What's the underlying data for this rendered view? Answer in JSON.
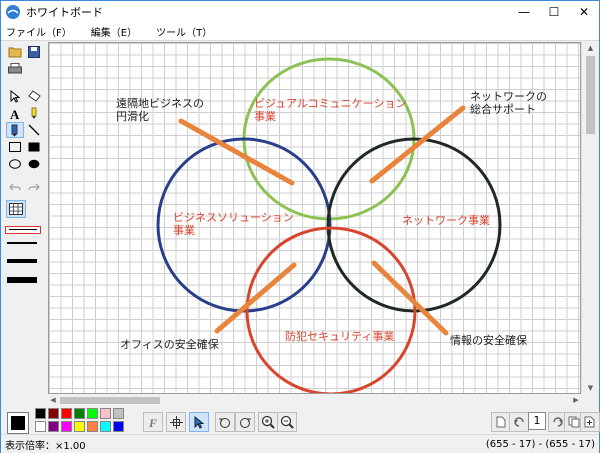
{
  "window": {
    "title": "ホワイトボード",
    "min": "—",
    "max": "☐",
    "close": "✕"
  },
  "menu": [
    "ファイル（F）",
    "編集（E）",
    "ツール（T）"
  ],
  "canvas": {
    "labels": {
      "top_circle": [
        "ビジュアルコミュニケーション",
        "事業"
      ],
      "left_circle": [
        "ビジネスソリューション",
        "事業"
      ],
      "right_circle": [
        "ネットワーク事業"
      ],
      "bottom_circle": [
        "防犯セキュリティ事業"
      ],
      "remote": [
        "遠隔地ビジネスの",
        "円滑化"
      ],
      "network_support": [
        "ネットワークの",
        "総合サポート"
      ],
      "office": [
        "オフィスの安全確保"
      ],
      "info": [
        "情報の安全確保"
      ]
    },
    "colors": {
      "green": "#8cc153",
      "blue": "#2a3f8a",
      "black": "#1e2a22",
      "red": "#d8452e",
      "orange": "#e8843b"
    }
  },
  "palette": [
    "#000000",
    "#800000",
    "#ff0000",
    "#008000",
    "#00ff00",
    "#ffc0cb",
    "#c0c0c0",
    "#ffffff",
    "#800080",
    "#ff00ff",
    "#ffff00",
    "#ff8040",
    "#00ffff",
    "#0000ff"
  ],
  "page": {
    "current": "1"
  },
  "status": {
    "zoom": "表示倍率：×1.00",
    "coords": "(655 - 17) - (655 - 17)"
  }
}
